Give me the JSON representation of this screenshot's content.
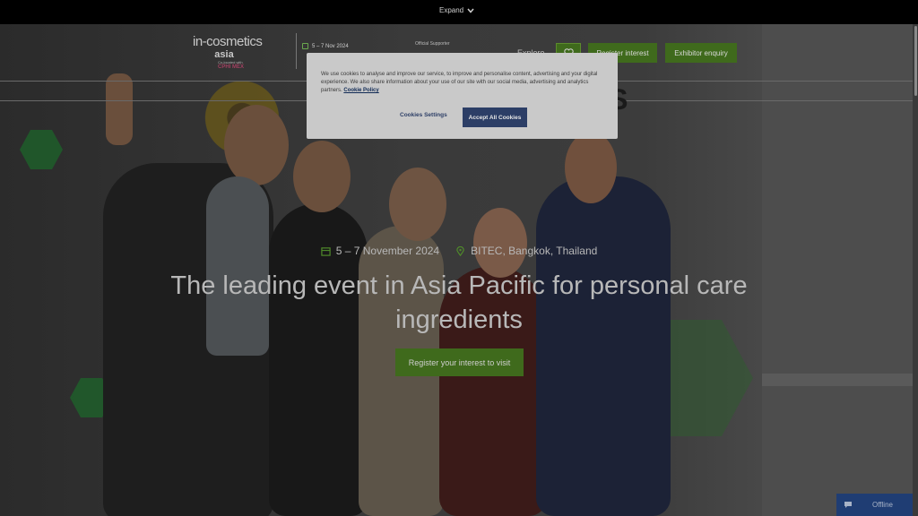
{
  "topbar": {
    "expand_label": "Expand"
  },
  "header": {
    "logo_main": "in-cosmetics",
    "logo_sub": "asia",
    "logo_tagline": "Co-located with",
    "logo_brand": "CPHI MEX",
    "event_date_short": "5 – 7 Nov 2024",
    "official_supporter": "Official Supporter",
    "explore_label": "Explore",
    "register_interest_label": "Register interest",
    "exhibitor_enquiry_label": "Exhibitor enquiry"
  },
  "hero": {
    "backdrop_letters": "CS",
    "date": "5 – 7 November 2024",
    "location": "BITEC, Bangkok, Thailand",
    "headline": "The leading event in Asia Pacific for personal care ingredients",
    "cta_label": "Register your interest to visit"
  },
  "cookie_banner": {
    "text": "We use cookies to analyse and improve our service, to improve and personalise content, advertising and your digital experience. We also share information about your use of our site with our social media, advertising and analytics partners.",
    "policy_link": "Cookie Policy",
    "settings_label": "Cookies Settings",
    "accept_label": "Accept All Cookies"
  },
  "chat_widget": {
    "status": "Offline"
  },
  "colors": {
    "accent_green": "#3f6a1c",
    "cookie_button": "#2c3e66",
    "chat_bg": "#1f3d73"
  }
}
